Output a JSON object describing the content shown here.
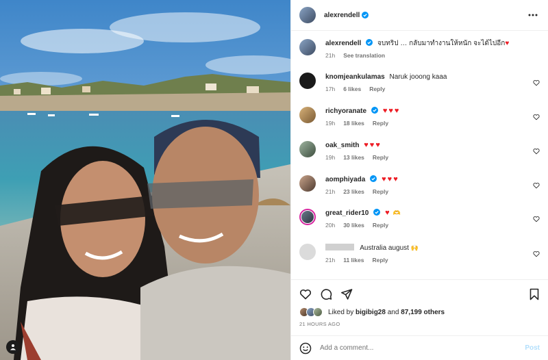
{
  "post": {
    "author": "alexrendell",
    "more_icon": "ellipsis-icon",
    "caption_text": "จบทริป … กลับมาทำงานให้หนัก จะได้ไปอีก",
    "caption_time": "21h",
    "see_translation": "See translation"
  },
  "comments": [
    {
      "username": "knomjeankulamas",
      "text": "Naruk jooong kaaa",
      "time": "17h",
      "likes": "6 likes",
      "reply": "Reply",
      "verified": false
    },
    {
      "username": "richyoranate",
      "text": "",
      "hearts": "♥♥♥",
      "time": "19h",
      "likes": "18 likes",
      "reply": "Reply",
      "verified": true
    },
    {
      "username": "oak_smith",
      "text": "",
      "hearts": "♥♥♥",
      "time": "19h",
      "likes": "13 likes",
      "reply": "Reply",
      "verified": false
    },
    {
      "username": "aomphiyada",
      "text": "",
      "hearts": "♥♥♥",
      "time": "21h",
      "likes": "23 likes",
      "reply": "Reply",
      "verified": true
    },
    {
      "username": "great_rider10",
      "text": "",
      "hearts": "♥",
      "emoji": "🫶",
      "time": "20h",
      "likes": "30 likes",
      "reply": "Reply",
      "verified": true
    },
    {
      "username": "",
      "text": "Australia august",
      "emoji": "🙌",
      "time": "21h",
      "likes": "11 likes",
      "reply": "Reply",
      "verified": false
    }
  ],
  "likes": {
    "prefix": "Liked by",
    "user": "bigibig28",
    "and": "and",
    "count": "87,199 others"
  },
  "timestamp": "21 HOURS AGO",
  "add_comment": {
    "placeholder": "Add a comment...",
    "post_label": "Post"
  },
  "colors": {
    "verified": "#0095f6",
    "heart": "#ed1c24",
    "post_disabled": "#b2dffc",
    "secondary_text": "#737373"
  }
}
